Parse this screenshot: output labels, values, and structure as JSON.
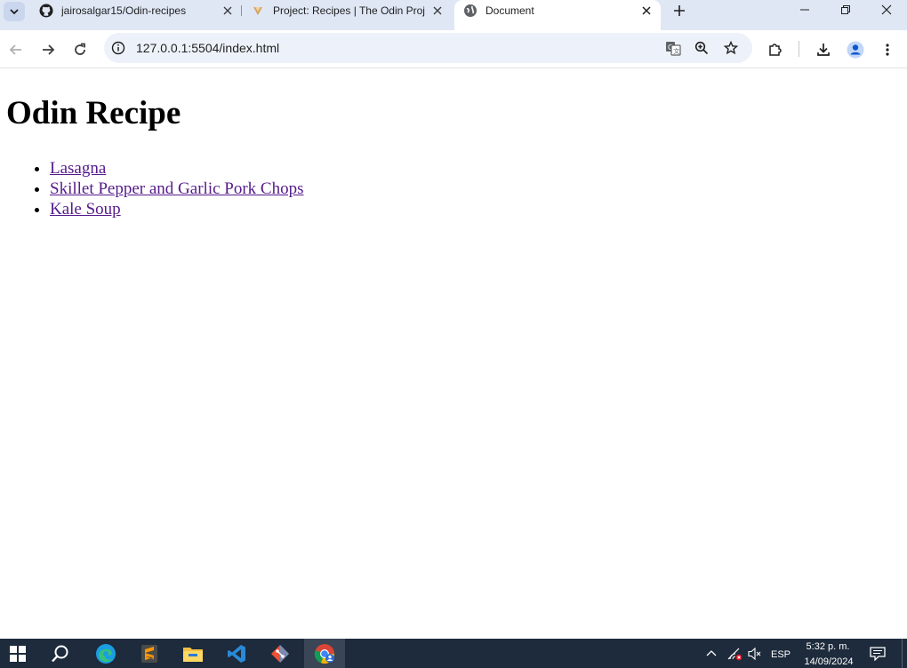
{
  "browser": {
    "tabs": [
      {
        "title": "jairosalgar15/Odin-recipes",
        "favicon": "github-icon",
        "active": false
      },
      {
        "title": "Project: Recipes | The Odin Project",
        "favicon": "odin-project-icon",
        "active": false
      },
      {
        "title": "Document",
        "favicon": "globe-icon",
        "active": true
      }
    ],
    "address_bar": {
      "url": "127.0.0.1:5504/index.html"
    },
    "window_controls": [
      "minimize",
      "restore",
      "close"
    ]
  },
  "page": {
    "heading": "Odin Recipe",
    "links": [
      {
        "label": "Lasagna"
      },
      {
        "label": "Skillet Pepper and Garlic Pork Chops"
      },
      {
        "label": "Kale Soup"
      }
    ],
    "link_color": "#551a8b"
  },
  "taskbar": {
    "apps": [
      "windows-start-icon",
      "search-icon",
      "edge-icon",
      "sublime-text-icon",
      "file-explorer-icon",
      "vscode-icon",
      "git-icon",
      "chrome-icon"
    ],
    "language": "ESP",
    "time": "5:32 p. m.",
    "date": "14/09/2024"
  },
  "colors": {
    "tabstrip": "#dfe7f5",
    "omnibox": "#edf2fa",
    "taskbar": "#1d2b3c"
  }
}
